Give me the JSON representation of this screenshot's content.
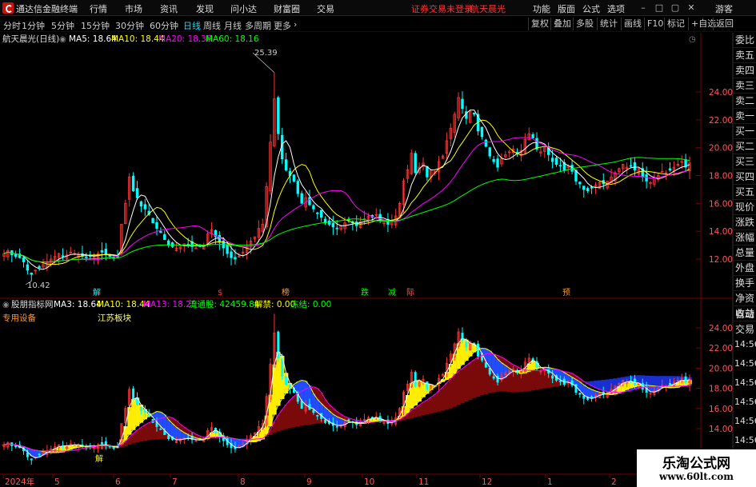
{
  "menubar": {
    "app_title": "通达信金融终端",
    "menus": [
      "行情",
      "市场",
      "资讯",
      "发现",
      "问小达",
      "财富圈",
      "交易"
    ],
    "notice": "证券交易未登录",
    "stock": "航天晨光",
    "right_menus": [
      "功能",
      "版面",
      "公式",
      "选项"
    ],
    "user": "游客"
  },
  "toolbar": {
    "periods": [
      "分时",
      "1分钟",
      "5分钟",
      "15分钟",
      "30分钟",
      "60分钟",
      "日线",
      "周线",
      "月线",
      "多周期",
      "更多"
    ],
    "active_period": "日线",
    "right_buttons": [
      "复权",
      "叠加",
      "多股",
      "统计",
      "画线",
      "F10",
      "标记",
      "+自选",
      "返回"
    ]
  },
  "main_chart": {
    "title": "航天晨光(日线)",
    "ma5_label": "MA5: 18.64",
    "ma10_label": "MA10: 18.44",
    "ma20_label": "MA20: 18.36",
    "ma60_label": "MA60: 18.16",
    "high_label": "25.39",
    "low_label": "10.42",
    "y_ticks": [
      "24.00",
      "22.00",
      "20.00",
      "18.00",
      "16.00",
      "14.00",
      "12.00"
    ],
    "signals": [
      "解",
      "$",
      "榜",
      "跌",
      "减",
      "际",
      "预"
    ]
  },
  "indicator": {
    "name": "股朋指标网",
    "ma3_label": "MA3: 18.64",
    "ma10_label": "MA10: 18.44",
    "ma13_label": "MA13: 18.25",
    "float_label": "流通股: 42459.84",
    "unlock_label": "解禁: 0.00",
    "freeze_label": "冻结: 0.00",
    "sector1": "专用设备",
    "sector2": "江苏板块",
    "bottom_signal": "解",
    "y_ticks": [
      "24.00",
      "22.00",
      "20.00",
      "18.00",
      "16.00",
      "14.00"
    ]
  },
  "right_panel": [
    "委比",
    "卖五",
    "卖四",
    "卖三",
    "卖二",
    "卖一",
    "买一",
    "买二",
    "买三",
    "买四",
    "买五",
    "现价",
    "涨跌",
    "涨幅",
    "总量",
    "外盘",
    "换手",
    "净资",
    "收益"
  ],
  "right_panel2": [
    "自动",
    "交易"
  ],
  "right_panel2_times": [
    "14:56",
    "14:56",
    "14:56",
    "14:56",
    "14:56",
    "14:56",
    "14:56"
  ],
  "x_axis": [
    "2024年",
    "5",
    "6",
    "7",
    "8",
    "9",
    "10",
    "11",
    "12",
    "1",
    "2"
  ],
  "watermark": {
    "line1": "乐淘公式网",
    "line2": "www.60lt.com"
  },
  "colors": {
    "up": "#ff3333",
    "down": "#00ffff",
    "ma5": "#ffffff",
    "ma10": "#ffff00",
    "ma20": "#ff00ff",
    "ma60": "#00ff00"
  },
  "chart_data": {
    "type": "candlestick",
    "ylim": [
      10,
      26
    ],
    "closes": [
      12.4,
      12.6,
      12.3,
      12.2,
      12.1,
      11.8,
      11.2,
      10.9,
      11.2,
      11.4,
      11.6,
      11.8,
      12.0,
      12.2,
      12.4,
      12.2,
      12.3,
      12.5,
      12.4,
      12.3,
      12.2,
      12.1,
      12.2,
      12.3,
      12.4,
      12.5,
      12.3,
      12.2,
      12.1,
      12.2,
      14.5,
      16.0,
      17.9,
      16.9,
      16.4,
      15.8,
      15.6,
      15.2,
      14.6,
      14.2,
      13.9,
      13.4,
      13.0,
      12.9,
      12.8,
      13.0,
      13.1,
      13.0,
      12.9,
      12.8,
      12.9,
      13.0,
      13.8,
      14.1,
      13.6,
      13.2,
      12.8,
      12.4,
      12.1,
      12.0,
      12.2,
      12.5,
      12.9,
      13.3,
      13.6,
      14.2,
      14.5,
      17.2,
      20.4,
      23.5,
      21.0,
      19.2,
      18.4,
      18.0,
      17.6,
      16.7,
      16.0,
      16.4,
      15.9,
      15.6,
      15.3,
      15.0,
      14.6,
      14.5,
      14.3,
      14.2,
      14.4,
      14.6,
      14.8,
      14.6,
      14.4,
      14.7,
      14.9,
      15.1,
      15.0,
      15.2,
      14.8,
      14.6,
      14.5,
      14.7,
      15.1,
      16.0,
      17.6,
      18.4,
      19.6,
      18.2,
      18.6,
      18.9,
      17.9,
      18.4,
      18.3,
      19.0,
      19.4,
      20.5,
      21.4,
      22.4,
      23.6,
      22.8,
      22.1,
      22.6,
      22.4,
      21.2,
      20.8,
      20.1,
      19.4,
      19.0,
      18.6,
      19.2,
      19.5,
      19.7,
      19.9,
      19.6,
      19.8,
      20.6,
      21.0,
      20.7,
      19.9,
      19.7,
      20.0,
      19.5,
      19.0,
      18.8,
      18.7,
      18.4,
      18.7,
      18.3,
      17.6,
      17.4,
      17.0,
      16.9,
      17.1,
      17.3,
      17.5,
      17.4,
      17.6,
      17.9,
      18.2,
      18.5,
      18.8,
      18.6,
      18.7,
      18.4,
      18.5,
      17.9,
      17.6,
      17.5,
      17.8,
      18.0,
      18.3,
      18.2,
      18.4,
      18.6,
      18.8,
      19.0,
      18.6,
      18.9
    ]
  }
}
